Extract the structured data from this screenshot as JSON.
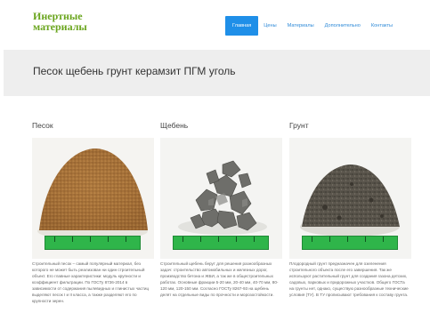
{
  "logo": {
    "line1": "Инертные",
    "line2": "материалы"
  },
  "nav": {
    "items": [
      {
        "label": "Главная",
        "active": true
      },
      {
        "label": "Цены",
        "active": false
      },
      {
        "label": "Материалы",
        "active": false
      },
      {
        "label": "Дополнительно",
        "active": false
      },
      {
        "label": "Контакты",
        "active": false
      }
    ]
  },
  "banner": {
    "title": "Песок щебень грунт керамзит ПГМ уголь"
  },
  "cards": [
    {
      "title": "Песок",
      "text": "Строительный песок – самый популярный материал, без которого не может быть реализован ни один строительный объект. Его главные характеристики: модуль крупности и коэффициент фильтрации. По ГОСТу 8736-2014 в зависимости от содержания пылевидных и глинистых частиц выделяют песок I и II класса, а также разделяют его по крупности зерен."
    },
    {
      "title": "Щебень",
      "text": "Строительный щебень берут для решения разнообразных задач: строительство автомобильных и железных дорог, производство бетона и ЖБИ, а так же в общестроительных работах. Основные фракции 5-20 мм, 20-40 мм, 40-70 мм, 80-120 мм, 120-150 мм. Согласно ГОСТу 8267-93 на щебень делят на отдельные виды по прочности и морозостойкости."
    },
    {
      "title": "Грунт",
      "text": "Плодородный грунт предназначен для озеленения строительного объекта после его завершения. Так же используют растительный грунт для создания газона детских, садовых, парковых и придорожных участков. Общего ГОСТа на грунты нет, однако, существую разнообразные технические условия (ТУ). В ТУ прописывают требования к составу грунта."
    }
  ],
  "colors": {
    "nav_active": "#1f8fe8",
    "nav_link": "#2e8ad8",
    "logo": "#6aa51e",
    "banner_bg": "#eeeeee",
    "ruler": "#2fb54a"
  }
}
